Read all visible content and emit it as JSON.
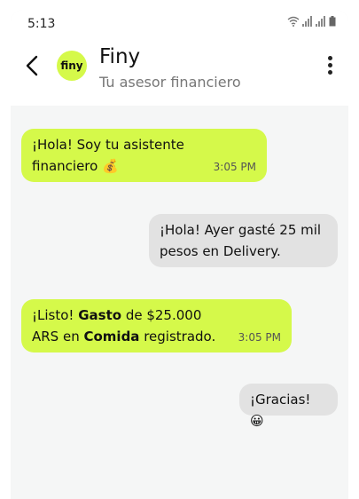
{
  "status_bar": {
    "time": "5:13"
  },
  "header": {
    "avatar_text": "finy",
    "title": "Finy",
    "subtitle": "Tu asesor financiero"
  },
  "messages": [
    {
      "from": "bot",
      "line1": "¡Hola! Soy tu asistente",
      "line2": "financiero 💰",
      "time": "3:05 PM"
    },
    {
      "from": "user",
      "line1": "¡Hola! Ayer gasté 25 mil",
      "line2": "pesos en Delivery."
    },
    {
      "from": "bot",
      "l1a": "¡Listo! ",
      "l1b": "Gasto",
      "l1c": " de $25.000",
      "l2a": "ARS en ",
      "l2b": "Comida",
      "l2c": " registrado.",
      "time": "3:05 PM"
    },
    {
      "from": "user",
      "line1": "¡Gracias! 😀"
    }
  ],
  "colors": {
    "bot_bubble": "#d5f94a",
    "user_bubble": "#e2e2e2",
    "background": "#f5f6f6"
  }
}
